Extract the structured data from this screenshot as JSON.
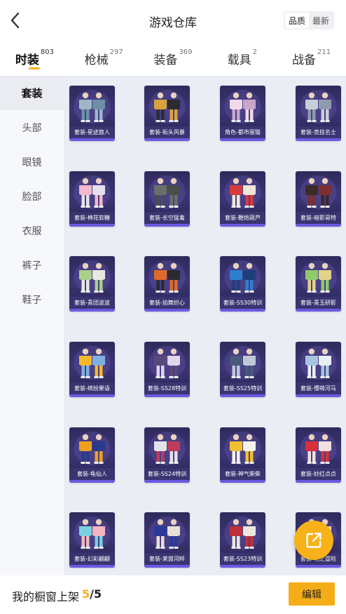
{
  "header": {
    "title": "游戏仓库",
    "sort_options": [
      "品质",
      "最新"
    ],
    "sort_active": 0
  },
  "tabs": [
    {
      "label": "时装",
      "count": "803",
      "active": true
    },
    {
      "label": "枪械",
      "count": "297"
    },
    {
      "label": "装备",
      "count": "369"
    },
    {
      "label": "载具",
      "count": "2"
    },
    {
      "label": "战备",
      "count": "211"
    }
  ],
  "sidebar": {
    "items": [
      "套装",
      "头部",
      "眼镜",
      "脸部",
      "衣服",
      "裤子",
      "鞋子"
    ],
    "active": 0
  },
  "items": [
    {
      "caption": "套装-星迹旅人",
      "colors": [
        "#9fb6c8",
        "#6f8fa8"
      ]
    },
    {
      "caption": "套装-街头风暴",
      "colors": [
        "#d9a23a",
        "#2b2b33"
      ]
    },
    {
      "caption": "角色-都市丽猫",
      "colors": [
        "#f3d8ea",
        "#c7a6c9"
      ]
    },
    {
      "caption": "套装-竞技名士",
      "colors": [
        "#c9cfd8",
        "#8e9ab0"
      ]
    },
    {
      "caption": "套装-棉花软糖",
      "colors": [
        "#f2b8cc",
        "#e6e0ea"
      ]
    },
    {
      "caption": "套装-长空猛禽",
      "colors": [
        "#6b6f6a",
        "#4a4e4b"
      ]
    },
    {
      "caption": "套装-鞭炮葫芦",
      "colors": [
        "#d83b3b",
        "#f0e6d8"
      ]
    },
    {
      "caption": "套装-暗影哥特",
      "colors": [
        "#3a2a2a",
        "#7a3030"
      ]
    },
    {
      "caption": "套装-青团波波",
      "colors": [
        "#a9d08a",
        "#e8e8e0"
      ]
    },
    {
      "caption": "套装-焰舞炽心",
      "colors": [
        "#e06a2a",
        "#2a2a30"
      ]
    },
    {
      "caption": "套装-SS30特训",
      "colors": [
        "#2f7fd0",
        "#1f3f7a"
      ]
    },
    {
      "caption": "套装-青玉研影",
      "colors": [
        "#8fc96a",
        "#e2d38a"
      ]
    },
    {
      "caption": "套装-缤纷果语",
      "colors": [
        "#f5b82a",
        "#7fb0e0"
      ]
    },
    {
      "caption": "套装-SS28特训",
      "colors": [
        "#5a4a7a",
        "#e0d6ee"
      ]
    },
    {
      "caption": "套装-SS25特训",
      "colors": [
        "#4a5a7a",
        "#c0c8d8"
      ]
    },
    {
      "caption": "套装-懵萌河马",
      "colors": [
        "#a6c6e0",
        "#e8f0f5"
      ]
    },
    {
      "caption": "套装-龟仙人",
      "colors": [
        "#f0a020",
        "#2a3a8a"
      ]
    },
    {
      "caption": "套装-SS24特训",
      "colors": [
        "#e6e2ea",
        "#c03a5a"
      ]
    },
    {
      "caption": "套装-神气柴柴",
      "colors": [
        "#f0c030",
        "#f5f2ea"
      ]
    },
    {
      "caption": "套装-妙红点点",
      "colors": [
        "#d8303a",
        "#f0e0e0"
      ]
    },
    {
      "caption": "套装-幻彩翩翩",
      "colors": [
        "#7ad0e0",
        "#f2b6c0"
      ]
    },
    {
      "caption": "套装-莱茵河畔",
      "colors": [
        "#2a3a9a",
        "#e8e0d8"
      ]
    },
    {
      "caption": "套装-SS23特训",
      "colors": [
        "#c0303a",
        "#ece6e0"
      ]
    },
    {
      "caption": "套装-花之冒险",
      "colors": [
        "#6fb8d8",
        "#f0e0b0"
      ]
    }
  ],
  "bottom": {
    "label": "我的橱窗上架",
    "current": "5",
    "total": "/5",
    "edit_label": "编辑"
  },
  "colors": {
    "accent": "#f5b21b",
    "card_bg": "#2e2a5c",
    "grid_bg": "#eaedf3"
  },
  "icons": {
    "back": "chevron-left-icon",
    "share": "share-external-icon"
  }
}
